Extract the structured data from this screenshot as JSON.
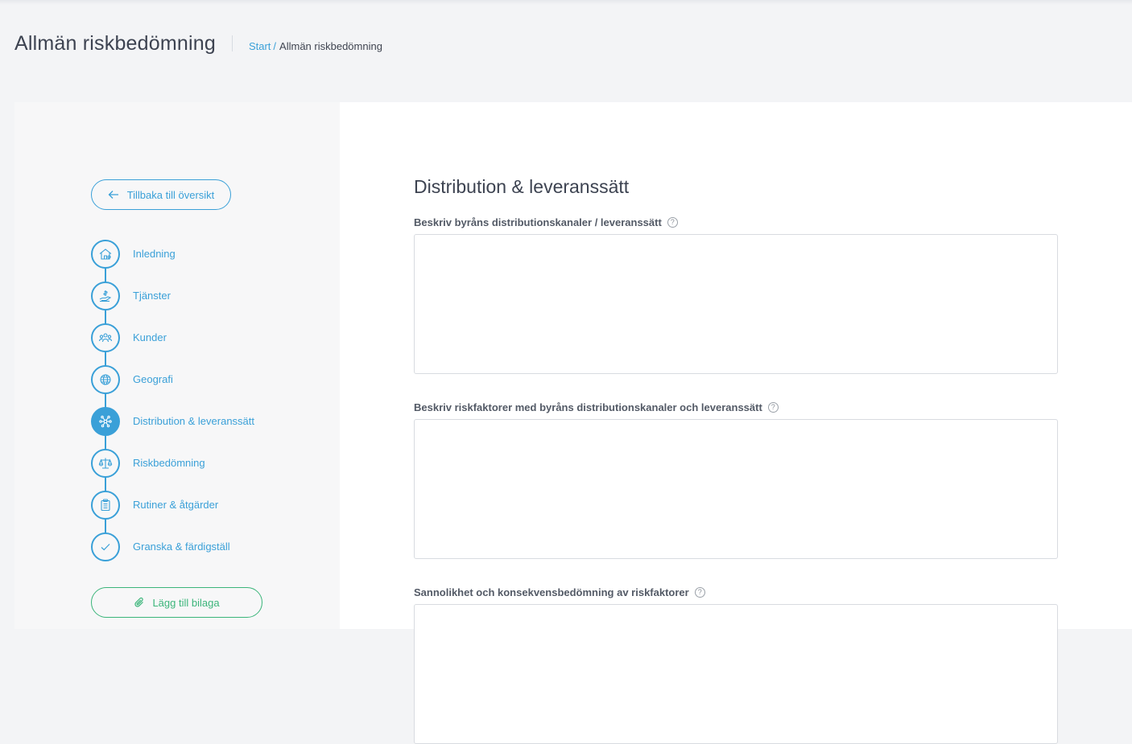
{
  "header": {
    "title": "Allmän riskbedömning",
    "breadcrumb": {
      "home": "Start",
      "separator": "/",
      "current": "Allmän riskbedömning"
    }
  },
  "sidebar": {
    "back_button": "Tillbaka till översikt",
    "steps": [
      {
        "label": "Inledning",
        "icon": "house-icon",
        "active": false
      },
      {
        "label": "Tjänster",
        "icon": "hand-coin-icon",
        "active": false
      },
      {
        "label": "Kunder",
        "icon": "people-icon",
        "active": false
      },
      {
        "label": "Geografi",
        "icon": "globe-icon",
        "active": false
      },
      {
        "label": "Distribution & leveranssätt",
        "icon": "network-icon",
        "active": true
      },
      {
        "label": "Riskbedömning",
        "icon": "scale-icon",
        "active": false
      },
      {
        "label": "Rutiner & åtgärder",
        "icon": "clipboard-icon",
        "active": false
      },
      {
        "label": "Granska & färdigställ",
        "icon": "check-icon",
        "active": false
      }
    ],
    "attach_button": "Lägg till bilaga"
  },
  "main": {
    "section_title": "Distribution & leveranssätt",
    "fields": [
      {
        "label": "Beskriv byråns distributionskanaler / leveranssätt",
        "value": "",
        "help": "?"
      },
      {
        "label": "Beskriv riskfaktorer med byråns distributionskanaler och leveranssätt",
        "value": "",
        "help": "?"
      },
      {
        "label": "Sannolikhet och konsekvensbedömning av riskfaktorer",
        "value": "",
        "help": "?"
      }
    ]
  },
  "colors": {
    "accent": "#3aa0d8",
    "success": "#3bb57a",
    "background": "#f3f4f6",
    "sidebar": "#f7f7f8",
    "panel": "#ffffff"
  }
}
